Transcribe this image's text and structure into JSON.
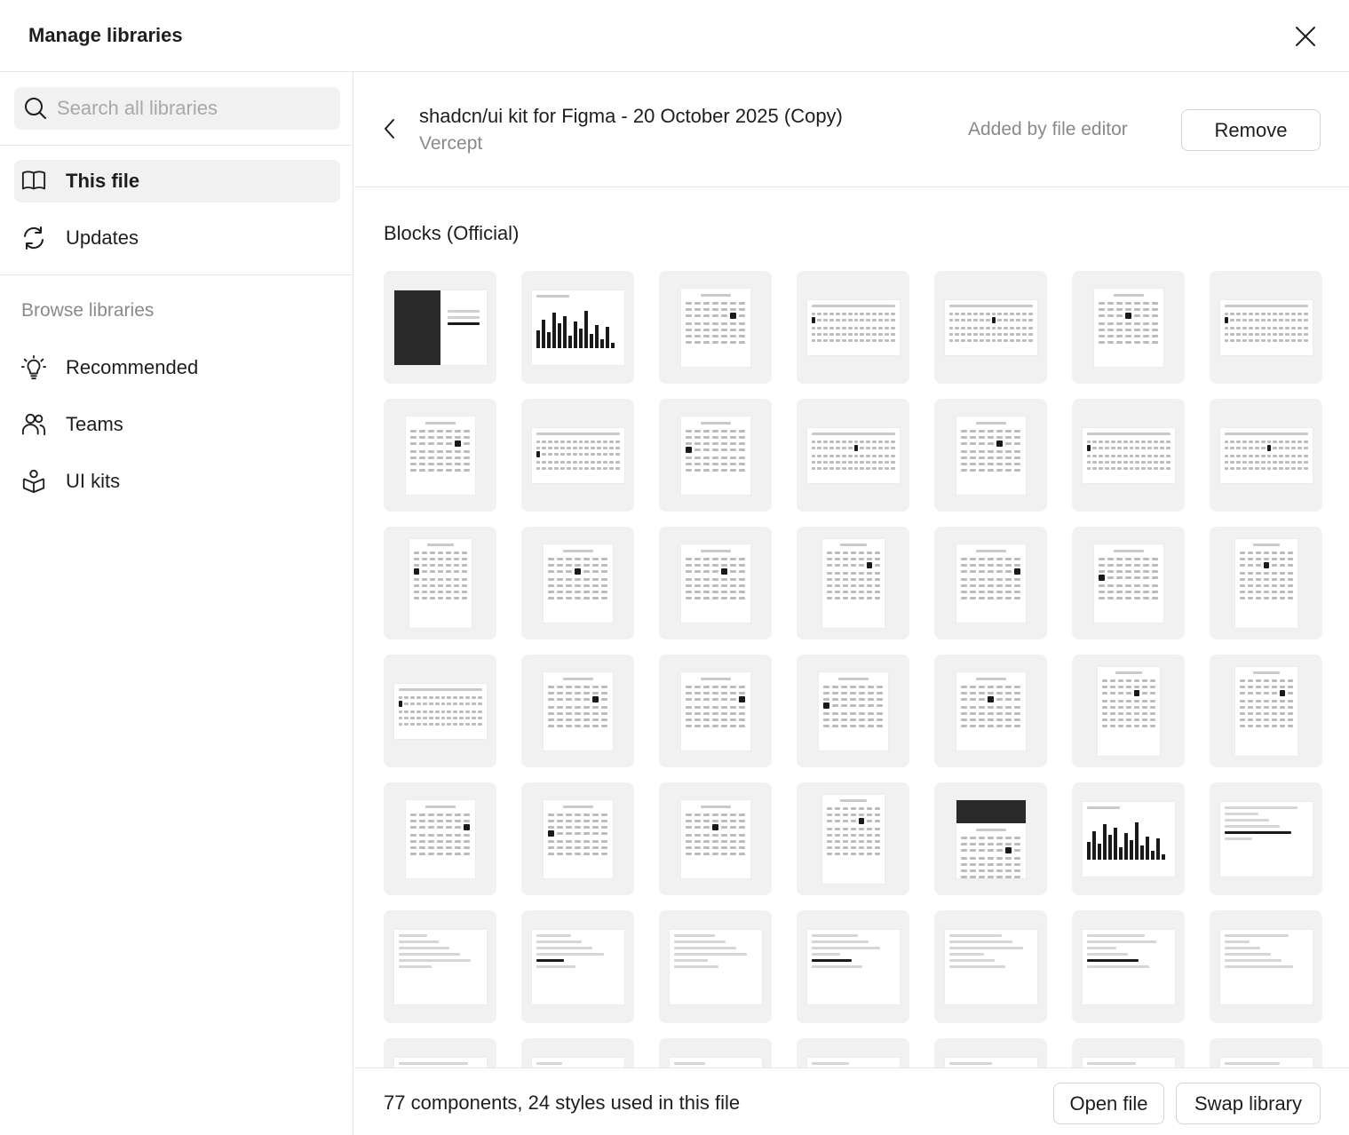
{
  "dialog": {
    "title": "Manage libraries",
    "close_icon": "close-icon"
  },
  "sidebar": {
    "search_placeholder": "Search all libraries",
    "items": [
      {
        "label": "This file",
        "icon": "book-icon",
        "active": true
      },
      {
        "label": "Updates",
        "icon": "refresh-icon",
        "active": false
      }
    ],
    "browse_heading": "Browse libraries",
    "browse_items": [
      {
        "label": "Recommended",
        "icon": "lightbulb-icon"
      },
      {
        "label": "Teams",
        "icon": "people-icon"
      },
      {
        "label": "UI kits",
        "icon": "package-icon"
      }
    ]
  },
  "library": {
    "title": "shadcn/ui kit for Figma - 20 October 2025 (Copy)",
    "author": "Vercept",
    "added_by": "Added by file editor",
    "remove_label": "Remove"
  },
  "section": {
    "title": "Blocks (Official)",
    "tile_count": 49
  },
  "footer": {
    "usage": "77 components, 24 styles used in this file",
    "open_label": "Open file",
    "swap_label": "Swap library"
  },
  "colors": {
    "accent_text": "#1e1e1e",
    "muted_text": "#8a8a8a",
    "tile_bg": "#f1f1f1",
    "border": "#e6e6e6"
  }
}
